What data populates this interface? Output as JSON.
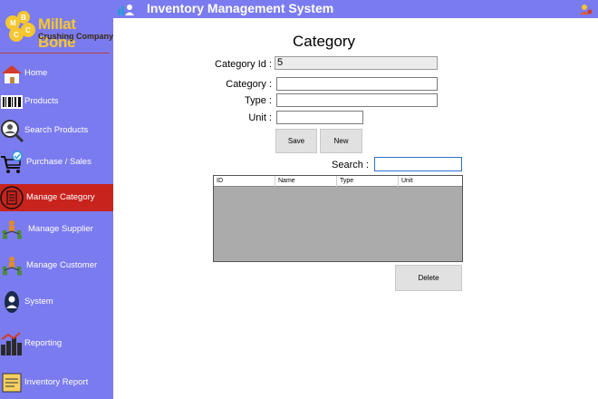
{
  "window": {
    "title": "Inventory Management System"
  },
  "brand": {
    "name": "Millat Bone",
    "tagline": "Crushing Company"
  },
  "sidebar": {
    "items": [
      {
        "label": "Home",
        "icon": "home-icon"
      },
      {
        "label": "Products",
        "icon": "barcode-icon"
      },
      {
        "label": "Search Products",
        "icon": "magnifier-icon"
      },
      {
        "label": "Purchase / Sales",
        "icon": "cart-icon"
      },
      {
        "label": "Manage Category",
        "icon": "document-icon",
        "active": true
      },
      {
        "label": "Manage Supplier",
        "icon": "people-network-icon"
      },
      {
        "label": "Manage Customer",
        "icon": "people-network-icon"
      },
      {
        "label": "System",
        "icon": "user-icon"
      },
      {
        "label": "Reporting",
        "icon": "bar-chart-icon"
      },
      {
        "label": "Inventory Report",
        "icon": "report-icon"
      }
    ]
  },
  "form": {
    "title": "Category",
    "category_id": {
      "label": "Category Id :",
      "value": "5"
    },
    "category": {
      "label": "Category :",
      "value": ""
    },
    "type": {
      "label": "Type :",
      "value": ""
    },
    "unit": {
      "label": "Unit :",
      "value": ""
    },
    "save_label": "Save",
    "new_label": "New",
    "search": {
      "label": "Search :",
      "value": ""
    },
    "delete_label": "Delete"
  },
  "grid": {
    "columns": [
      "ID",
      "Name",
      "Type",
      "Unit"
    ],
    "rows": []
  },
  "colors": {
    "sidebar": "#7b7bf0",
    "active_item": "#c8231c",
    "brand_text": "#f6c630",
    "grid_background": "#ababab"
  }
}
